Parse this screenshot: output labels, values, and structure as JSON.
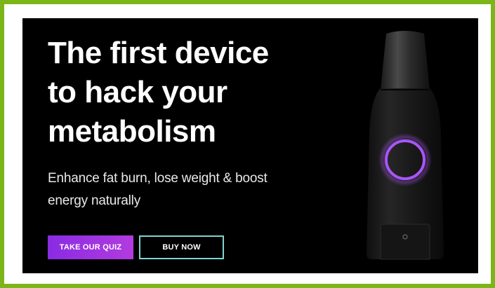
{
  "banner": {
    "headline_lines": [
      "The first device",
      "to hack your",
      "metabolism"
    ],
    "subheadline": "Enhance fat burn, lose weight & boost energy naturally",
    "buttons": {
      "quiz_label": "TAKE OUR QUIZ",
      "buy_label": "BUY NOW"
    }
  },
  "colors": {
    "page_border": "#7cb518",
    "banner_background": "#000000",
    "quiz_button": "#a234e0",
    "buy_button_border": "#7fd3cf",
    "device_ring": "#a855f7"
  },
  "icons": {
    "device": "metabolism-device-image"
  }
}
